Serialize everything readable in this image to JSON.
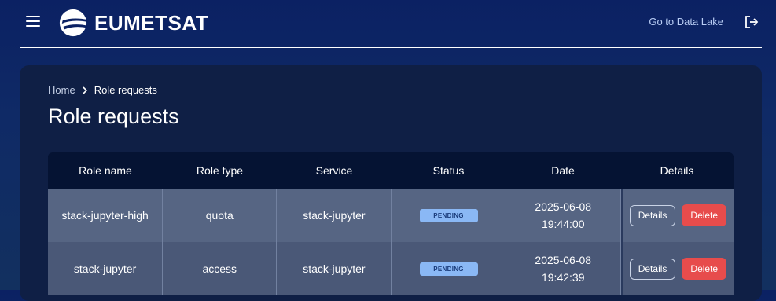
{
  "header": {
    "brand": "EUMETSAT",
    "menu_icon": "hamburger-menu-icon",
    "logo_icon": "eumetsat-logo-icon",
    "data_lake_link": "Go to Data Lake",
    "logout_icon": "logout-icon"
  },
  "breadcrumb": {
    "home": "Home",
    "separator_icon": "chevron-right-icon",
    "current": "Role requests"
  },
  "page": {
    "title": "Role requests"
  },
  "table": {
    "columns": [
      "Role name",
      "Role type",
      "Service",
      "Status",
      "Date",
      "Details"
    ],
    "rows": [
      {
        "role_name": "stack-jupyter-high",
        "role_type": "quota",
        "service": "stack-jupyter",
        "status": "PENDING",
        "date": "2025-06-08",
        "time": "19:44:00",
        "details_label": "Details",
        "delete_label": "Delete"
      },
      {
        "role_name": "stack-jupyter",
        "role_type": "access",
        "service": "stack-jupyter",
        "status": "PENDING",
        "date": "2025-06-08",
        "time": "19:42:39",
        "details_label": "Details",
        "delete_label": "Delete"
      }
    ]
  },
  "colors": {
    "background": "#0f2a66",
    "card": "#0f1f45",
    "header_row": "#051333",
    "pending_badge": "#8ab8f5",
    "delete_button": "#e74c4c"
  }
}
